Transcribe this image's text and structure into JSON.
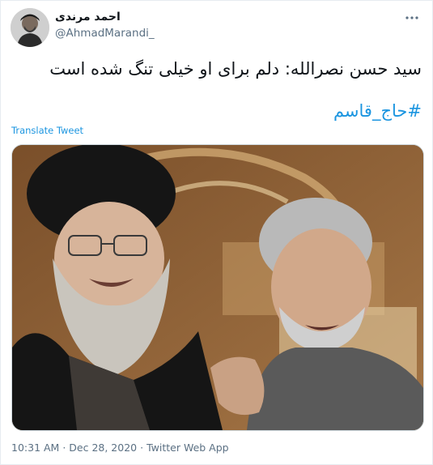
{
  "author": {
    "display_name": "احمد مرندی",
    "handle": "@AhmadMarandi_"
  },
  "tweet": {
    "text": "سید حسن نصرالله: دلم برای او خیلی تنگ شده است",
    "hashtag": "#حاج_قاسم",
    "translate_label": "Translate Tweet"
  },
  "meta": {
    "time": "10:31 AM",
    "separator": "·",
    "date": "Dec 28, 2020",
    "source": "Twitter Web App"
  },
  "icons": {
    "more": "more-dots-icon"
  },
  "colors": {
    "link": "#1b95e0",
    "muted": "#5b7083"
  }
}
